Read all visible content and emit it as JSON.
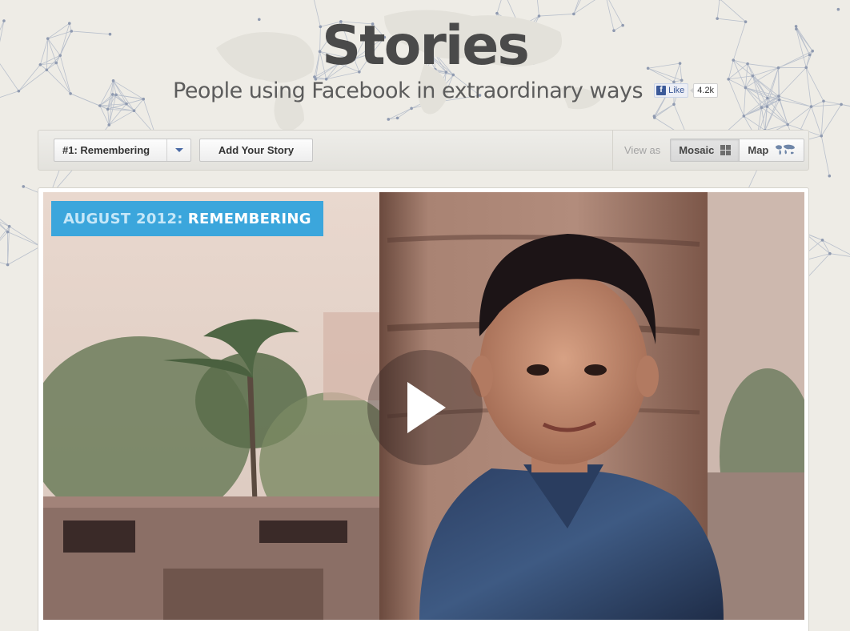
{
  "header": {
    "title": "Stories",
    "subtitle": "People using Facebook in extraordinary ways",
    "like_label": "Like",
    "like_count": "4.2k"
  },
  "toolbar": {
    "chapter_select_value": "#1: Remembering",
    "add_story_label": "Add Your Story",
    "view_as_label": "View as",
    "view_options": [
      {
        "label": "Mosaic",
        "icon": "mosaic-grid-icon",
        "active": true
      },
      {
        "label": "Map",
        "icon": "world-map-icon",
        "active": false
      }
    ]
  },
  "feature": {
    "badge_date": "AUGUST 2012:",
    "badge_theme": "REMEMBERING",
    "play_icon": "play-icon"
  },
  "colors": {
    "background": "#eeece6",
    "badge_bg": "#3ba6dc",
    "facebook_blue": "#3b5998",
    "title": "#4a4a4a"
  }
}
